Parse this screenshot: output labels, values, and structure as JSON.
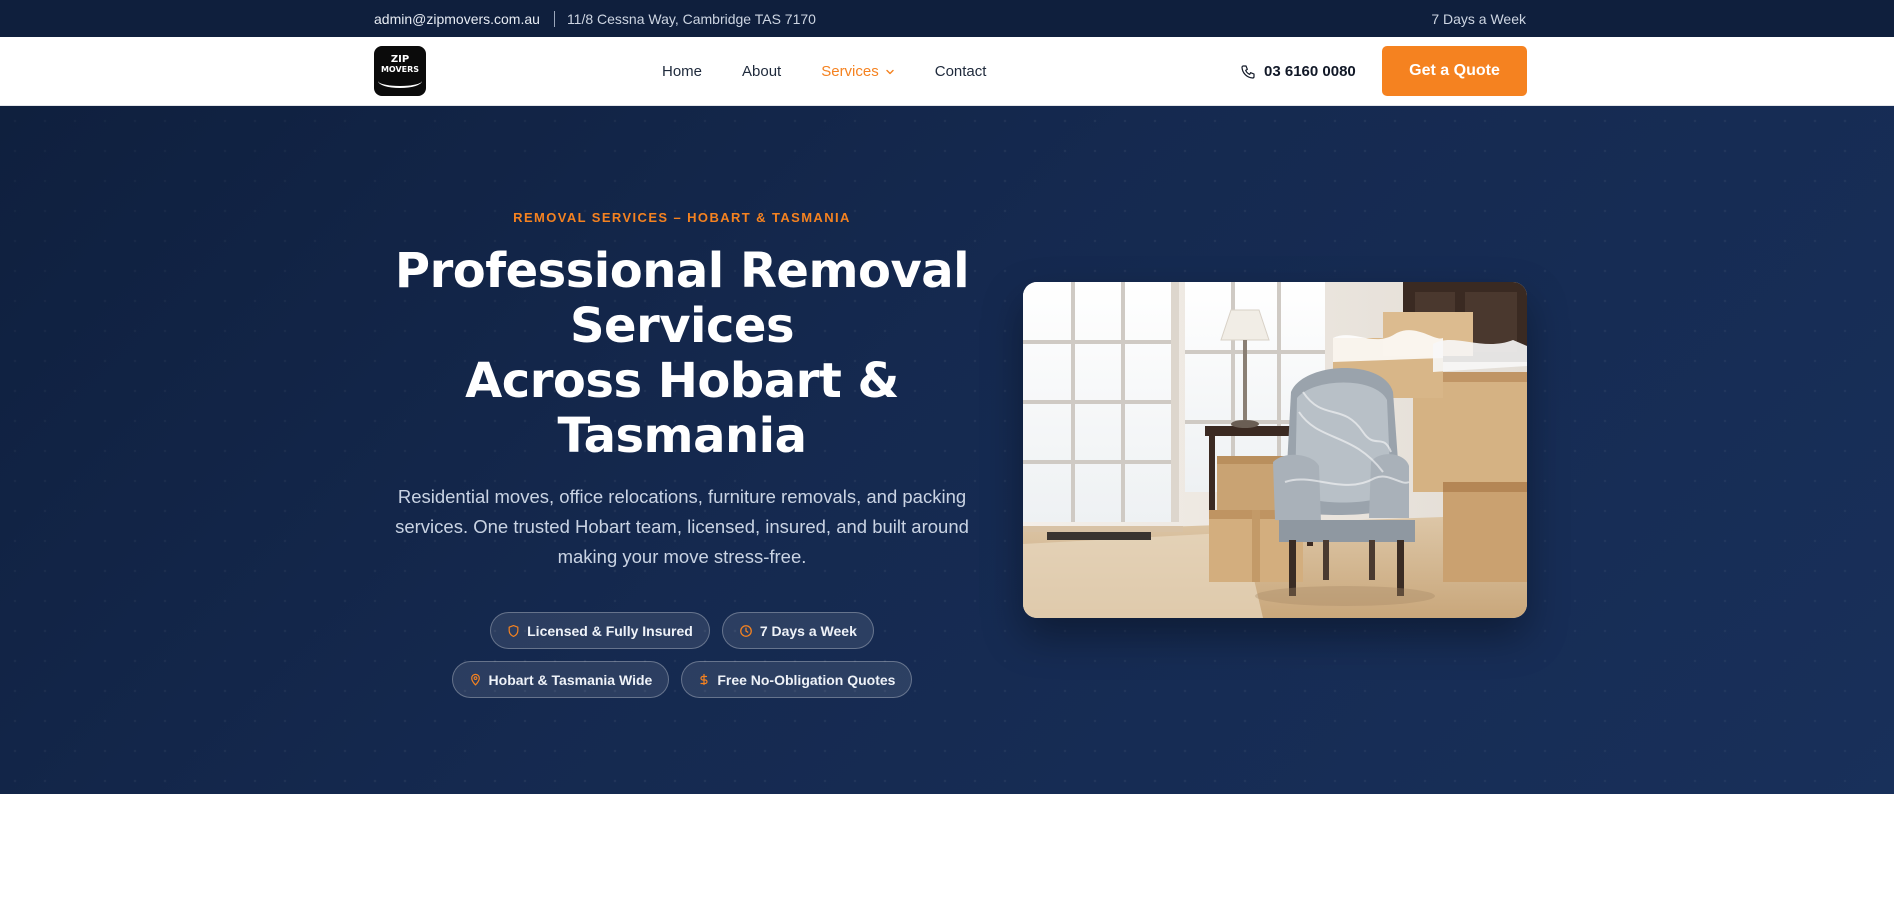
{
  "topbar": {
    "email": "admin@zipmovers.com.au",
    "address": "11/8 Cessna Way, Cambridge TAS 7170",
    "hours": "7 Days a Week"
  },
  "brand": {
    "logo_line1": "ZIP",
    "logo_line2": "MOVERS"
  },
  "nav": {
    "items": [
      {
        "label": "Home"
      },
      {
        "label": "About"
      },
      {
        "label": "Services"
      },
      {
        "label": "Contact"
      }
    ],
    "phone": "03 6160 0080",
    "cta": "Get a Quote"
  },
  "hero": {
    "eyebrow": "REMOVAL SERVICES – HOBART & TASMANIA",
    "headline_line1": "Professional Removal",
    "headline_line2": "Services",
    "headline_line3": "Across Hobart &",
    "headline_line4": "Tasmania",
    "subtext": "Residential moves, office relocations, furniture removals, and packing services. One trusted Hobart team, licensed, insured, and built around making your move stress-free.",
    "badges": [
      {
        "label": "Licensed & Fully Insured",
        "icon": "shield-icon"
      },
      {
        "label": "7 Days a Week",
        "icon": "clock-icon"
      },
      {
        "label": "Hobart & Tasmania Wide",
        "icon": "map-pin-icon"
      },
      {
        "label": "Free No-Obligation Quotes",
        "icon": "dollar-icon"
      }
    ]
  },
  "colors": {
    "accent": "#f58220",
    "topbar": "#0f1f3d",
    "hero": "#15294f"
  }
}
